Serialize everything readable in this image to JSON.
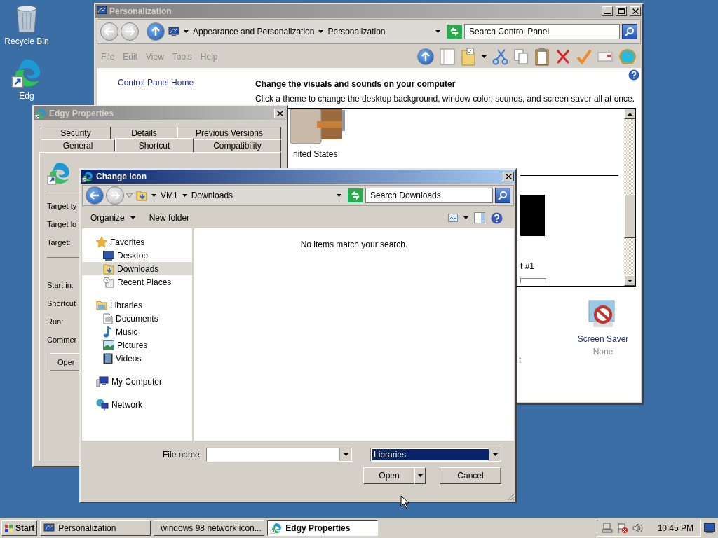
{
  "desktop": {
    "icons": [
      {
        "label": "Recycle Bin",
        "kind": "recycle"
      },
      {
        "label": "Edg",
        "kind": "edge"
      }
    ]
  },
  "personalization": {
    "title": "Personalization",
    "active": false,
    "breadcrumb": [
      "Appearance and Personalization",
      "Personalization"
    ],
    "search": {
      "placeholder": "Search Control Panel"
    },
    "menu": [
      {
        "label": "File",
        "disabled": true
      },
      {
        "label": "Edit",
        "disabled": true
      },
      {
        "label": "View",
        "disabled": true
      },
      {
        "label": "Tools",
        "disabled": true
      },
      {
        "label": "Help",
        "disabled": true
      }
    ],
    "sidebar_link": "Control Panel Home",
    "heading": "Change the visuals and sounds on your computer",
    "description": "Click a theme to change the desktop background, window color, sounds, and screen saver all at once.",
    "theme_label": "nited States",
    "item_label": "t #1",
    "settings": [
      {
        "label": "t",
        "kind": "cut"
      },
      {
        "label": "Screen Saver",
        "value": "None",
        "kind": "screensaver"
      }
    ]
  },
  "properties": {
    "title": "Edgy Properties",
    "active": false,
    "tab_rows": [
      [
        {
          "label": "Security",
          "selected": false
        },
        {
          "label": "Details",
          "selected": false
        },
        {
          "label": "Previous Versions",
          "selected": false
        }
      ],
      [
        {
          "label": "General",
          "selected": false
        },
        {
          "label": "Shortcut",
          "selected": true
        },
        {
          "label": "Compatibility",
          "selected": false
        }
      ]
    ],
    "fields": [
      "Target ty",
      "Target lo",
      "Target:",
      "Start in:",
      "Shortcut",
      "Run:",
      "Commer"
    ],
    "button": "Oper"
  },
  "change_icon": {
    "title": "Change Icon",
    "active": true,
    "path": [
      "VM1",
      "Downloads"
    ],
    "search": {
      "placeholder": "Search Downloads"
    },
    "toolbar": [
      "Organize",
      "New folder"
    ],
    "nav": [
      {
        "label": "Favorites",
        "children": [
          {
            "label": "Desktop",
            "selected": false
          },
          {
            "label": "Downloads",
            "selected": true
          },
          {
            "label": "Recent Places",
            "selected": false
          }
        ]
      },
      {
        "label": "Libraries",
        "children": [
          {
            "label": "Documents",
            "selected": false
          },
          {
            "label": "Music",
            "selected": false
          },
          {
            "label": "Pictures",
            "selected": false
          },
          {
            "label": "Videos",
            "selected": false
          }
        ]
      },
      {
        "label": "My Computer"
      },
      {
        "label": "Network"
      }
    ],
    "empty_message": "No items match your search.",
    "file_name_label": "File name:",
    "file_type": {
      "value": "Libraries",
      "highlighted": true
    },
    "buttons": [
      "Open",
      "Cancel"
    ]
  },
  "taskbar": {
    "start": "Start",
    "tasks": [
      {
        "label": "Personalization",
        "selected": false,
        "kind": "cpl"
      },
      {
        "label": "windows 98 network icon...",
        "selected": false,
        "kind": "chrome"
      },
      {
        "label": "Edgy Properties",
        "selected": true,
        "kind": "edge"
      }
    ],
    "time": "10:45 PM"
  }
}
